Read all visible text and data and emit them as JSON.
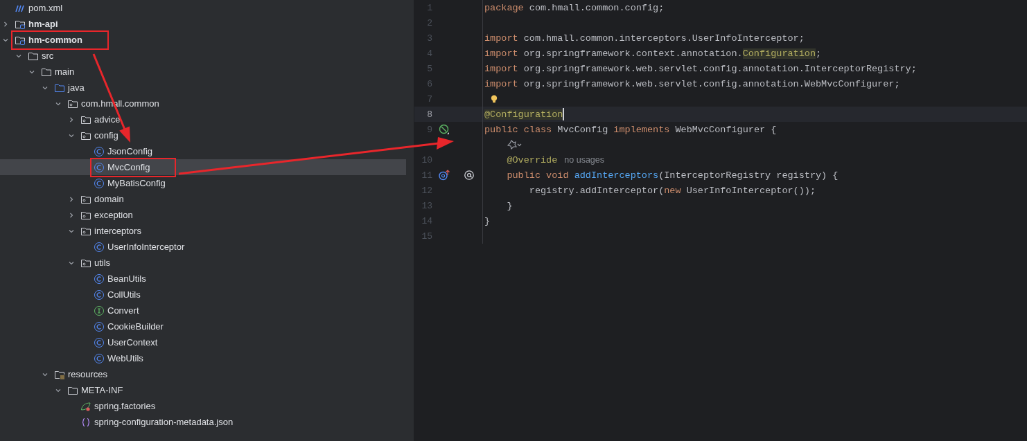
{
  "project_tree": [
    {
      "label": "pom.xml",
      "kind": "maven",
      "selected": false,
      "boxed": false
    },
    {
      "label": "hm-api",
      "kind": "module",
      "bold": true,
      "expanded": false,
      "selected": false,
      "boxed": false
    },
    {
      "label": "hm-common",
      "kind": "module",
      "bold": true,
      "expanded": true,
      "selected": false,
      "boxed": true,
      "children": [
        {
          "label": "src",
          "kind": "folder",
          "expanded": true,
          "selected": false,
          "boxed": false,
          "children": [
            {
              "label": "main",
              "kind": "folder",
              "expanded": true,
              "selected": false,
              "boxed": false,
              "children": [
                {
                  "label": "java",
                  "kind": "source",
                  "expanded": true,
                  "selected": false,
                  "boxed": false,
                  "children": [
                    {
                      "label": "com.hmall.common",
                      "kind": "package",
                      "expanded": true,
                      "selected": false,
                      "boxed": false,
                      "children": [
                        {
                          "label": "advice",
                          "kind": "package",
                          "expanded": false,
                          "selected": false,
                          "boxed": false
                        },
                        {
                          "label": "config",
                          "kind": "package",
                          "expanded": true,
                          "selected": false,
                          "boxed": false,
                          "children": [
                            {
                              "label": "JsonConfig",
                              "kind": "class",
                              "selected": false,
                              "boxed": false
                            },
                            {
                              "label": "MvcConfig",
                              "kind": "class",
                              "selected": true,
                              "boxed": true
                            },
                            {
                              "label": "MyBatisConfig",
                              "kind": "class",
                              "selected": false,
                              "boxed": false
                            }
                          ]
                        },
                        {
                          "label": "domain",
                          "kind": "package",
                          "expanded": false,
                          "selected": false,
                          "boxed": false
                        },
                        {
                          "label": "exception",
                          "kind": "package",
                          "expanded": false,
                          "selected": false,
                          "boxed": false
                        },
                        {
                          "label": "interceptors",
                          "kind": "package",
                          "expanded": true,
                          "selected": false,
                          "boxed": false,
                          "children": [
                            {
                              "label": "UserInfoInterceptor",
                              "kind": "class",
                              "selected": false,
                              "boxed": false
                            }
                          ]
                        },
                        {
                          "label": "utils",
                          "kind": "package",
                          "expanded": true,
                          "selected": false,
                          "boxed": false,
                          "children": [
                            {
                              "label": "BeanUtils",
                              "kind": "class",
                              "selected": false,
                              "boxed": false
                            },
                            {
                              "label": "CollUtils",
                              "kind": "class",
                              "selected": false,
                              "boxed": false
                            },
                            {
                              "label": "Convert",
                              "kind": "interface",
                              "selected": false,
                              "boxed": false
                            },
                            {
                              "label": "CookieBuilder",
                              "kind": "class",
                              "selected": false,
                              "boxed": false
                            },
                            {
                              "label": "UserContext",
                              "kind": "class",
                              "selected": false,
                              "boxed": false
                            },
                            {
                              "label": "WebUtils",
                              "kind": "class",
                              "selected": false,
                              "boxed": false
                            }
                          ]
                        }
                      ]
                    }
                  ]
                },
                {
                  "label": "resources",
                  "kind": "resources",
                  "expanded": true,
                  "selected": false,
                  "boxed": false,
                  "children": [
                    {
                      "label": "META-INF",
                      "kind": "folder",
                      "expanded": true,
                      "selected": false,
                      "boxed": false,
                      "children": [
                        {
                          "label": "spring.factories",
                          "kind": "spring",
                          "selected": false,
                          "boxed": false
                        },
                        {
                          "label": "spring-configuration-metadata.json",
                          "kind": "json",
                          "selected": false,
                          "boxed": false
                        }
                      ]
                    }
                  ]
                }
              ]
            }
          ]
        }
      ]
    }
  ],
  "editor": {
    "lines": [
      {
        "kind": "line",
        "number": "1",
        "current": false,
        "tokens": [
          {
            "kind": "keyword",
            "text": "package"
          },
          {
            "kind": "plain",
            "text": " com.hmall.common.config;"
          }
        ]
      },
      {
        "kind": "line",
        "number": "2",
        "current": false
      },
      {
        "kind": "line",
        "number": "3",
        "current": false,
        "tokens": [
          {
            "kind": "keyword",
            "text": "import"
          },
          {
            "kind": "plain",
            "text": " com.hmall.common.interceptors.UserInfoInterceptor;"
          }
        ]
      },
      {
        "kind": "line",
        "number": "4",
        "current": false,
        "tokens": [
          {
            "kind": "keyword",
            "text": "import"
          },
          {
            "kind": "plain",
            "text": " org.springframework.context.annotation."
          },
          {
            "kind": "match",
            "text": "Configuration"
          },
          {
            "kind": "plain",
            "text": ";"
          }
        ]
      },
      {
        "kind": "line",
        "number": "5",
        "current": false,
        "tokens": [
          {
            "kind": "keyword",
            "text": "import"
          },
          {
            "kind": "plain",
            "text": " org.springframework.web.servlet.config.annotation.InterceptorRegistry;"
          }
        ]
      },
      {
        "kind": "line",
        "number": "6",
        "current": false,
        "tokens": [
          {
            "kind": "keyword",
            "text": "import"
          },
          {
            "kind": "plain",
            "text": " org.springframework.web.servlet.config.annotation.WebMvcConfigurer;"
          }
        ]
      },
      {
        "kind": "line",
        "number": "7",
        "current": false,
        "markers": [
          {
            "kind": "bulb"
          }
        ]
      },
      {
        "kind": "line",
        "number": "8",
        "current": true,
        "tokens": [
          {
            "kind": "match",
            "text": "@Configuration"
          }
        ]
      },
      {
        "kind": "line",
        "number": "9",
        "current": false,
        "markers": [
          {
            "kind": "bean"
          }
        ],
        "tokens": [
          {
            "kind": "keyword",
            "text": "public class "
          },
          {
            "kind": "plain",
            "text": "MvcConfig "
          },
          {
            "kind": "keyword",
            "text": "implements "
          },
          {
            "kind": "plain",
            "text": "WebMvcConfigurer {"
          }
        ]
      },
      {
        "kind": "inlay"
      },
      {
        "kind": "line",
        "number": "10",
        "current": false,
        "tokens": [
          {
            "kind": "annotation",
            "text": "    @Override"
          },
          {
            "kind": "hint",
            "text": "no usages"
          }
        ]
      },
      {
        "kind": "line",
        "number": "11",
        "current": false,
        "markers": [
          {
            "kind": "override"
          },
          {
            "kind": "at"
          }
        ],
        "tokens": [
          {
            "kind": "keyword",
            "text": "    public void "
          },
          {
            "kind": "method",
            "text": "addInterceptors"
          },
          {
            "kind": "plain",
            "text": "(InterceptorRegistry registry) {"
          }
        ]
      },
      {
        "kind": "line",
        "number": "12",
        "current": false,
        "tokens": [
          {
            "kind": "plain",
            "text": "        registry.addInterceptor("
          },
          {
            "kind": "keyword",
            "text": "new "
          },
          {
            "kind": "plain",
            "text": "UserInfoInterceptor());"
          }
        ]
      },
      {
        "kind": "line",
        "number": "13",
        "current": false,
        "tokens": [
          {
            "kind": "plain",
            "text": "    }"
          }
        ]
      },
      {
        "kind": "line",
        "number": "14",
        "current": false,
        "tokens": [
          {
            "kind": "plain",
            "text": "}"
          }
        ]
      },
      {
        "kind": "line",
        "number": "15",
        "current": false
      }
    ]
  }
}
